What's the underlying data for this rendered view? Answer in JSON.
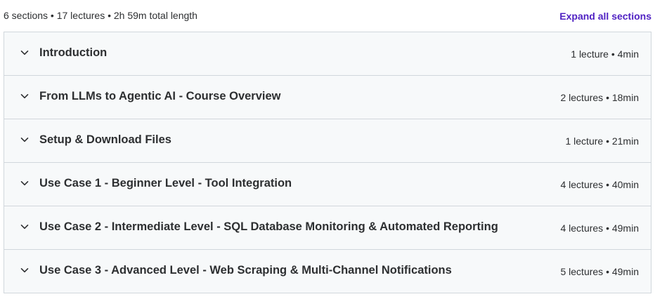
{
  "summary": {
    "text": "6 sections • 17 lectures • 2h 59m total length",
    "expand_label": "Expand all sections"
  },
  "colors": {
    "accent": "#5022c3",
    "row_background": "#f7f9fa",
    "border": "#d1d7dc",
    "text": "#2d2f31"
  },
  "sections": [
    {
      "icon": "chevron-down-icon",
      "title": "Introduction",
      "meta": "1 lecture • 4min"
    },
    {
      "icon": "chevron-down-icon",
      "title": "From LLMs to Agentic AI - Course Overview",
      "meta": "2 lectures • 18min"
    },
    {
      "icon": "chevron-down-icon",
      "title": "Setup & Download Files",
      "meta": "1 lecture • 21min"
    },
    {
      "icon": "chevron-down-icon",
      "title": "Use Case 1 - Beginner Level - Tool Integration",
      "meta": "4 lectures • 40min"
    },
    {
      "icon": "chevron-down-icon",
      "title": "Use Case 2 - Intermediate Level - SQL Database Monitoring & Automated Reporting",
      "meta": "4 lectures • 49min"
    },
    {
      "icon": "chevron-down-icon",
      "title": "Use Case 3 - Advanced Level - Web Scraping & Multi-Channel Notifications",
      "meta": "5 lectures • 49min"
    }
  ]
}
